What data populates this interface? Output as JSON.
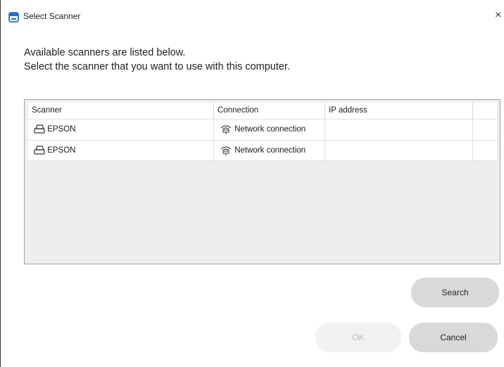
{
  "window": {
    "title": "Select Scanner",
    "close_glyph": "×",
    "app_icon": "scanner-app-icon"
  },
  "intro": {
    "line1": "Available scanners are listed below.",
    "line2": "Select the scanner that you want to use with this computer."
  },
  "table": {
    "columns": [
      "Scanner",
      "Connection",
      "IP address",
      ""
    ],
    "rows": [
      {
        "scanner": "EPSON",
        "scanner_icon": "printer-icon",
        "connection": "Network connection",
        "connection_icon": "network-icon",
        "ip": ""
      },
      {
        "scanner": "EPSON",
        "scanner_icon": "printer-icon",
        "connection": "Network connection",
        "connection_icon": "network-icon",
        "ip": ""
      }
    ]
  },
  "buttons": {
    "search": "Search",
    "ok": "OK",
    "cancel": "Cancel"
  },
  "colors": {
    "accent": "#1f6fd1",
    "list_background": "#eeeeee",
    "button_background": "#d9d9d9",
    "disabled_button_background": "#f2f2f2",
    "disabled_text": "#b9b9b9"
  }
}
